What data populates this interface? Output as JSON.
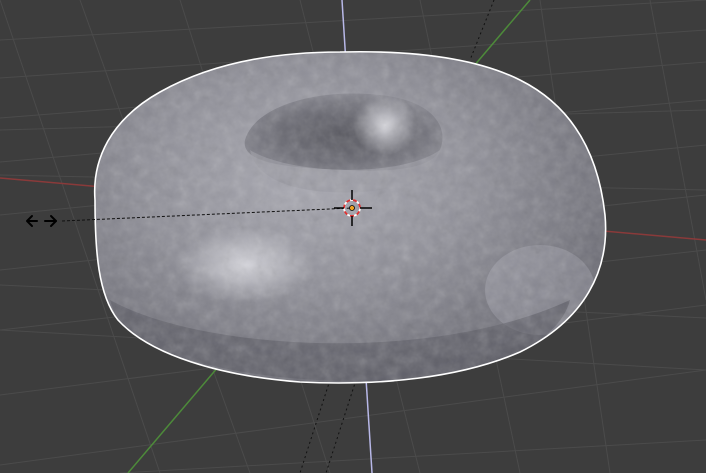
{
  "viewport": {
    "view_type": "3d-viewport",
    "background_color": "#3d3d3d",
    "grid_color": "#4a4a4a",
    "x_axis_color": "#8a3a3a",
    "y_axis_color": "#4d8a3a",
    "z_axis_color": "#b8b8e8",
    "selection_outline_color": "#ffffff"
  },
  "object": {
    "shape": "torus",
    "selected": true,
    "surface_color": "#8f8f98"
  },
  "tools": {
    "scale_cursor_icon": "double-arrow-horizontal",
    "cursor_3d_icon": "3d-cursor",
    "pivot_point_icon": "object-origin"
  }
}
